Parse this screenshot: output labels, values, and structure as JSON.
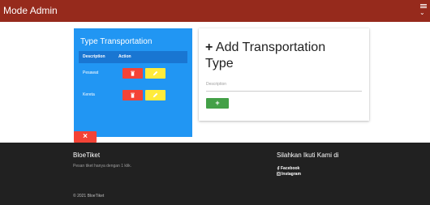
{
  "navbar": {
    "title": "Mode Admin",
    "menu_icon": "list-chevron-icon"
  },
  "type_card": {
    "title": "Type Transportation",
    "columns": {
      "description": "Description",
      "action": "Action"
    },
    "rows": [
      {
        "name": "Pesawat"
      },
      {
        "name": "Kereta"
      }
    ]
  },
  "add_card": {
    "title": "Add Transportation Type",
    "title_icon": "+",
    "description_label": "Description",
    "add_button_label": "+"
  },
  "close_button_label": "×",
  "footer": {
    "brand": "BloeTiket",
    "tagline": "Pesan tiket hanya dengan 1 klik.",
    "follow_title": "Silahkan Ikuti Kami di",
    "links": [
      "Facebook",
      "Instagram"
    ],
    "copyright": "© 2021 BloeTiket"
  },
  "colors": {
    "navbar": "#962a1c",
    "card_blue": "#2196f3",
    "header_blue": "#1976d2",
    "delete_red": "#f44336",
    "edit_yellow": "#ffeb3b",
    "add_green": "#43a047",
    "footer": "#212121"
  }
}
